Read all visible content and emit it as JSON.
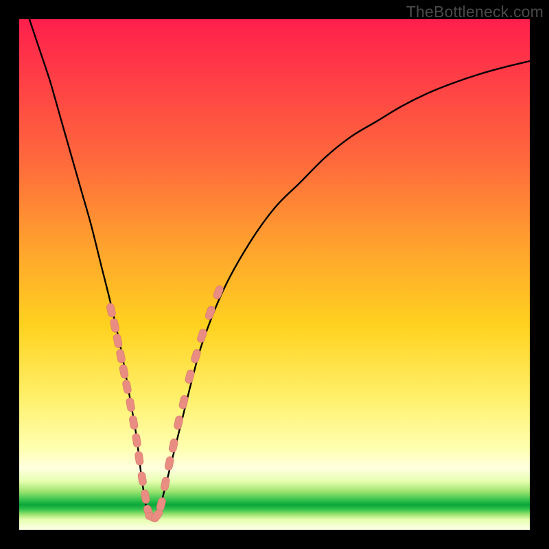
{
  "watermark": "TheBottleneck.com",
  "colors": {
    "curve": "#000000",
    "marker_fill": "#e98d82",
    "marker_stroke": "#d9776c",
    "background_black": "#000000"
  },
  "chart_data": {
    "type": "line",
    "title": "",
    "xlabel": "",
    "ylabel": "",
    "xlim": [
      0,
      100
    ],
    "ylim": [
      0,
      100
    ],
    "series": [
      {
        "name": "bottleneck-curve",
        "x": [
          2,
          4,
          6,
          8,
          10,
          12,
          14,
          16,
          18,
          20,
          22,
          23,
          24,
          25,
          26,
          27,
          28,
          30,
          32,
          34,
          36,
          40,
          45,
          50,
          55,
          60,
          65,
          70,
          75,
          80,
          85,
          90,
          95,
          100
        ],
        "y": [
          100,
          94,
          88,
          81,
          74,
          67,
          60,
          52,
          44,
          35,
          24,
          18,
          10,
          4,
          2.5,
          3,
          6,
          14,
          22,
          30,
          37,
          47,
          56,
          63,
          68,
          73,
          77,
          80,
          83,
          85.5,
          87.5,
          89.2,
          90.6,
          91.8
        ]
      }
    ],
    "markers": {
      "name": "highlighted-points",
      "points": [
        {
          "x": 18.0,
          "y": 43.0
        },
        {
          "x": 18.7,
          "y": 40.0
        },
        {
          "x": 19.3,
          "y": 37.0
        },
        {
          "x": 19.9,
          "y": 34.0
        },
        {
          "x": 20.5,
          "y": 31.0
        },
        {
          "x": 21.1,
          "y": 28.0
        },
        {
          "x": 21.8,
          "y": 24.5
        },
        {
          "x": 22.4,
          "y": 21.0
        },
        {
          "x": 23.0,
          "y": 17.5
        },
        {
          "x": 23.5,
          "y": 14.0
        },
        {
          "x": 24.1,
          "y": 10.0
        },
        {
          "x": 24.7,
          "y": 6.5
        },
        {
          "x": 25.3,
          "y": 3.5
        },
        {
          "x": 26.0,
          "y": 2.5
        },
        {
          "x": 27.0,
          "y": 2.8
        },
        {
          "x": 27.8,
          "y": 5.0
        },
        {
          "x": 28.6,
          "y": 9.0
        },
        {
          "x": 29.4,
          "y": 13.0
        },
        {
          "x": 30.2,
          "y": 16.5
        },
        {
          "x": 31.2,
          "y": 21.0
        },
        {
          "x": 32.2,
          "y": 25.0
        },
        {
          "x": 33.4,
          "y": 30.0
        },
        {
          "x": 34.6,
          "y": 34.0
        },
        {
          "x": 35.8,
          "y": 38.0
        },
        {
          "x": 37.4,
          "y": 42.5
        },
        {
          "x": 39.0,
          "y": 46.5
        }
      ]
    }
  }
}
